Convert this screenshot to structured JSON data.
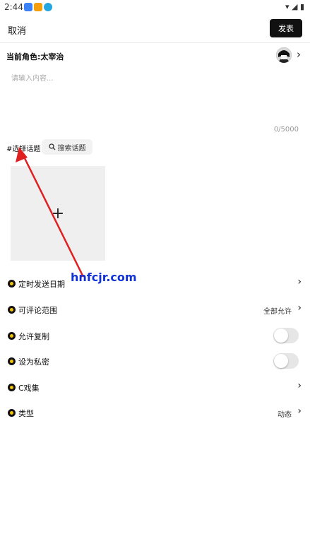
{
  "status_bar": {
    "time": "2:44"
  },
  "header": {
    "cancel_label": "取消",
    "publish_label": "发表"
  },
  "role": {
    "label": "当前角色:太宰治"
  },
  "editor": {
    "placeholder": "请输入内容...",
    "char_count": "0/5000"
  },
  "topics": {
    "select_label": "#选择话题",
    "search_label": "搜索话题"
  },
  "media": {
    "add_symbol": "+"
  },
  "settings": [
    {
      "label": "定时发送日期",
      "value": ""
    },
    {
      "label": "可评论范围",
      "value": "全部允许"
    },
    {
      "label": "允许复制",
      "toggle": false
    },
    {
      "label": "设为私密",
      "toggle": false
    },
    {
      "label": "C戏集",
      "value": ""
    },
    {
      "label": "类型",
      "value": "动态"
    }
  ],
  "watermark": "hnfcjr.com",
  "colors": {
    "accent": "#111111",
    "bullet_inner": "#f2c400",
    "arrow": "#e02020",
    "watermark": "#1030d8"
  }
}
